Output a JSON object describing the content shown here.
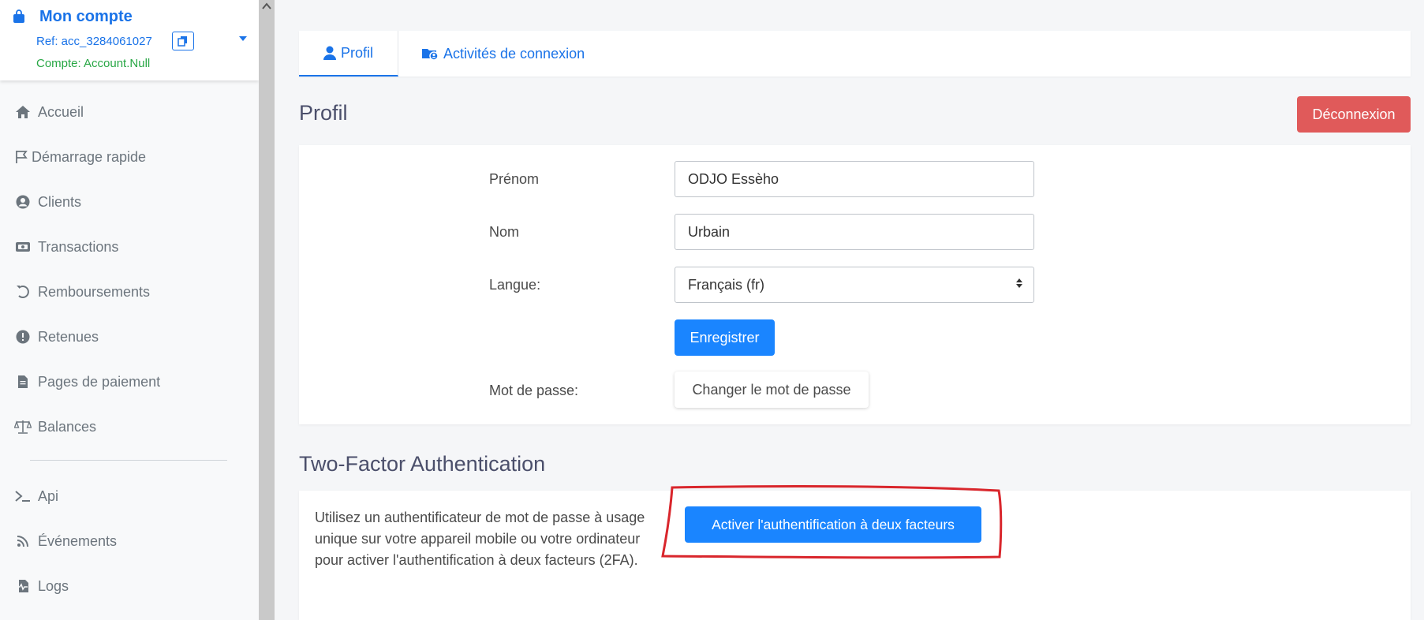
{
  "account": {
    "title": "Mon compte",
    "ref": "Ref: acc_3284061027",
    "status": "Compte: Account.Null",
    "icons": {
      "bag": "shopping-bag-icon",
      "copy": "copy-icon",
      "caret": "caret-down-icon"
    }
  },
  "sidebar": {
    "items": [
      {
        "label": "Accueil",
        "icon": "home-icon"
      },
      {
        "label": "Démarrage rapide",
        "icon": "flag-icon"
      },
      {
        "label": "Clients",
        "icon": "user-circle-icon"
      },
      {
        "label": "Transactions",
        "icon": "money-icon"
      },
      {
        "label": "Remboursements",
        "icon": "undo-icon"
      },
      {
        "label": "Retenues",
        "icon": "exclamation-icon"
      },
      {
        "label": "Pages de paiement",
        "icon": "file-icon"
      },
      {
        "label": "Balances",
        "icon": "scale-icon"
      },
      {
        "label": "Api",
        "icon": "terminal-icon"
      },
      {
        "label": "Événements",
        "icon": "rss-icon"
      },
      {
        "label": "Logs",
        "icon": "log-file-icon"
      }
    ]
  },
  "tabs": [
    {
      "label": "Profil",
      "icon": "user-icon",
      "active": true
    },
    {
      "label": "Activités de connexion",
      "icon": "folder-user-icon",
      "active": false
    }
  ],
  "profile": {
    "heading": "Profil",
    "logout_label": "Déconnexion",
    "firstname_label": "Prénom",
    "firstname_value": "ODJO Essèho",
    "lastname_label": "Nom",
    "lastname_value": "Urbain",
    "language_label": "Langue:",
    "language_value": "Français (fr)",
    "save_label": "Enregistrer",
    "password_label": "Mot de passe:",
    "change_password_label": "Changer le mot de passe"
  },
  "twofa": {
    "heading": "Two-Factor Authentication",
    "description": "Utilisez un authentificateur de mot de passe à usage unique sur votre appareil mobile ou votre ordinateur pour activer l'authentification à deux facteurs (2FA).",
    "activate_label": "Activer l'authentification à deux facteurs"
  },
  "colors": {
    "accent": "#1a73e8",
    "primary_button": "#1a85ff",
    "danger": "#e05a5a",
    "success": "#28a745",
    "annotation": "#d9262c"
  }
}
